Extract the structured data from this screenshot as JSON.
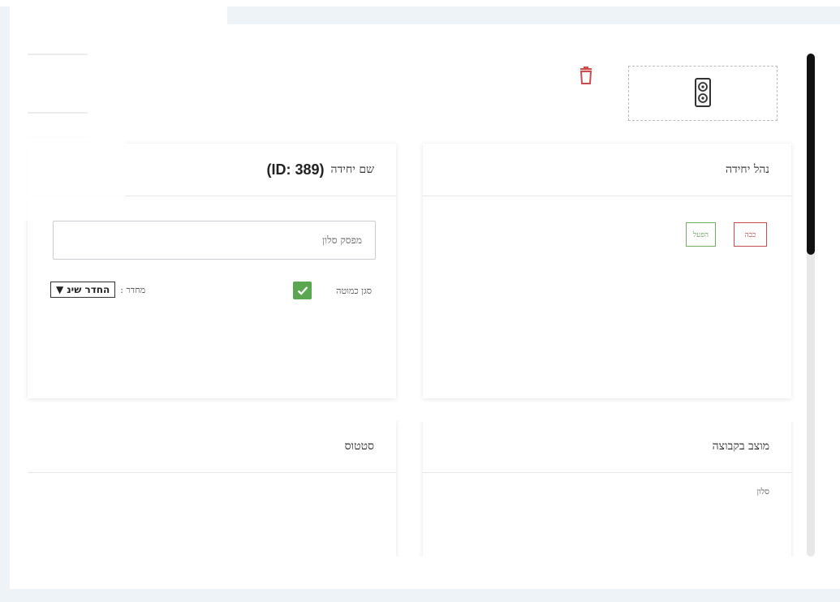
{
  "card_unit_name": {
    "title_label": "שם יחידה",
    "title_id": "(ID: 389)",
    "name_value": "מפסק סלון",
    "checkbox_label": "סגן כמוטה",
    "room_label": "מחדר :",
    "room_selected": "החדר שינ",
    "room_arrow": "▼"
  },
  "card_manage_unit": {
    "title": "נהל יחידה",
    "cancel_label": "כבה",
    "confirm_label": "הפעל"
  },
  "card_status": {
    "title": "סטטוס"
  },
  "card_group_state": {
    "title": "מוצב בקבוצה",
    "value": "סלון"
  },
  "icons": {
    "trash": "trash-icon",
    "device": "speaker-device-icon",
    "check": "checkmark-icon"
  },
  "colors": {
    "danger": "#cf4b4b",
    "success": "#5ba751"
  }
}
